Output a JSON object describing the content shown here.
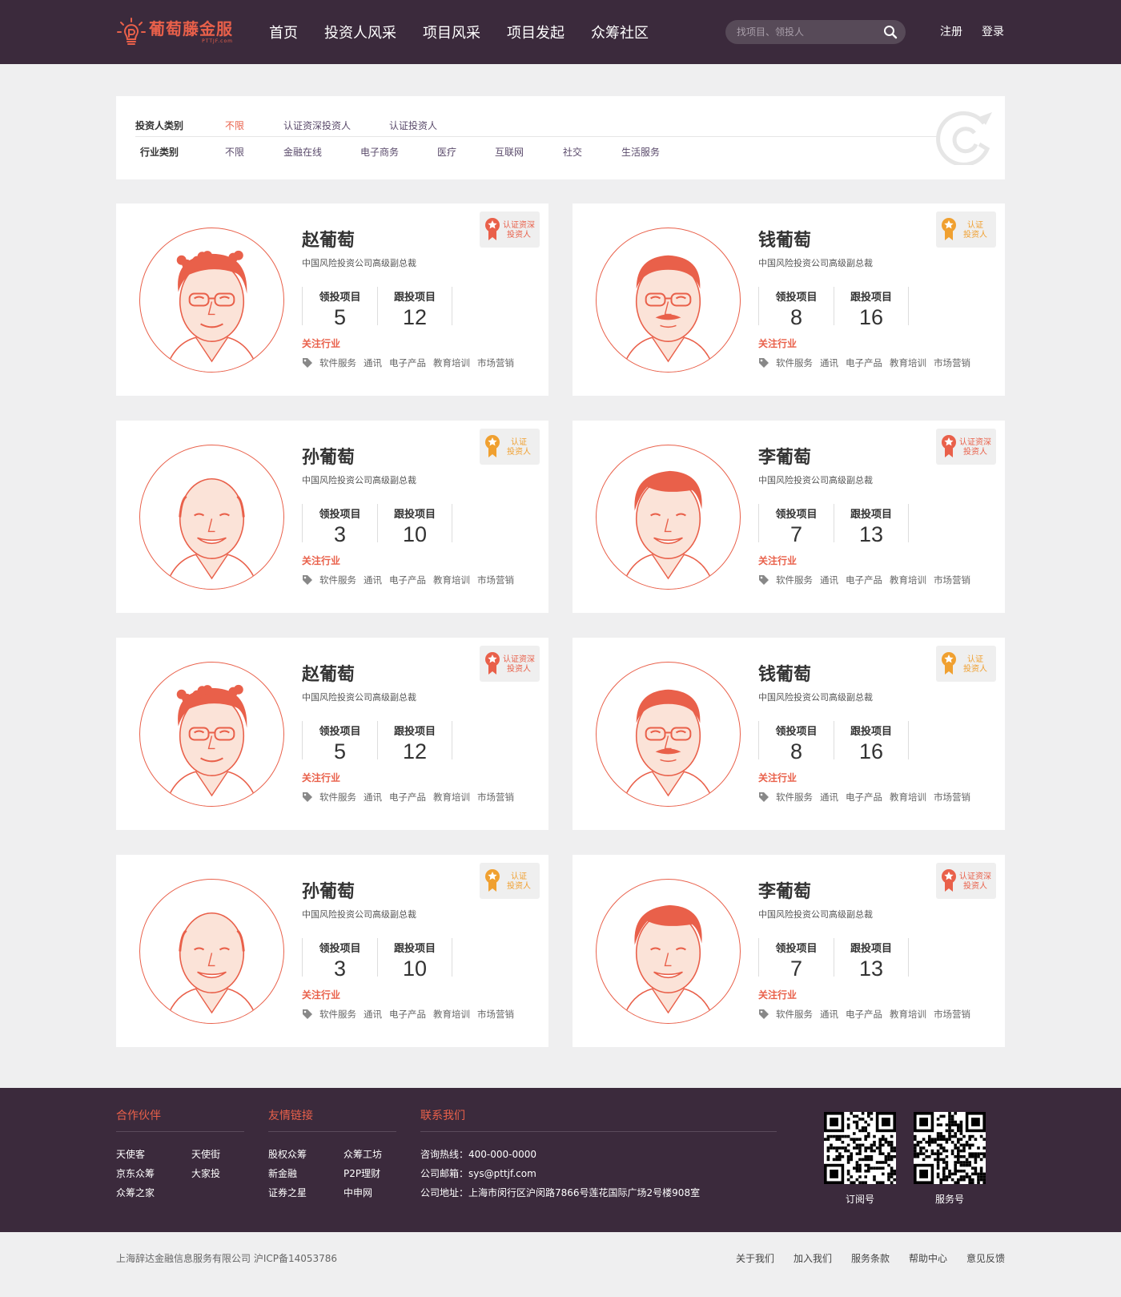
{
  "brand": {
    "name": "葡萄藤金服",
    "domain": "PTTJF.com",
    "accent": "#e9604a",
    "header_bg": "#3b2a3c"
  },
  "nav": [
    "首页",
    "投资人风采",
    "项目风采",
    "项目发起",
    "众筹社区"
  ],
  "search": {
    "placeholder": "找项目、领投人"
  },
  "auth": {
    "register": "注册",
    "login": "登录"
  },
  "filters": {
    "investor_type": {
      "label": "投资人类别",
      "options": [
        "不限",
        "认证资深投资人",
        "认证投资人"
      ],
      "selected": "不限"
    },
    "industry": {
      "label": "行业类别",
      "options": [
        "不限",
        "金融在线",
        "电子商务",
        "医疗",
        "互联网",
        "社交",
        "生活服务"
      ]
    }
  },
  "card_labels": {
    "lead": "领投项目",
    "follow": "跟投项目",
    "industry": "关注行业"
  },
  "badges": {
    "senior": [
      "认证资深",
      "投资人"
    ],
    "normal": [
      "认证",
      "投资人"
    ]
  },
  "investors": [
    {
      "name": "赵葡萄",
      "title": "中国风险投资公司高级副总裁",
      "lead": "5",
      "follow": "12",
      "badge": "senior",
      "face": "curly",
      "tags": [
        "软件服务",
        "通讯",
        "电子产品",
        "教育培训",
        "市场营销"
      ]
    },
    {
      "name": "钱葡萄",
      "title": "中国风险投资公司高级副总裁",
      "lead": "8",
      "follow": "16",
      "badge": "normal",
      "face": "mustache",
      "tags": [
        "软件服务",
        "通讯",
        "电子产品",
        "教育培训",
        "市场营销"
      ]
    },
    {
      "name": "孙葡萄",
      "title": "中国风险投资公司高级副总裁",
      "lead": "3",
      "follow": "10",
      "badge": "normal",
      "face": "bald",
      "tags": [
        "软件服务",
        "通讯",
        "电子产品",
        "教育培训",
        "市场营销"
      ]
    },
    {
      "name": "李葡萄",
      "title": "中国风险投资公司高级副总裁",
      "lead": "7",
      "follow": "13",
      "badge": "senior",
      "face": "parted",
      "tags": [
        "软件服务",
        "通讯",
        "电子产品",
        "教育培训",
        "市场营销"
      ]
    },
    {
      "name": "赵葡萄",
      "title": "中国风险投资公司高级副总裁",
      "lead": "5",
      "follow": "12",
      "badge": "senior",
      "face": "curly",
      "tags": [
        "软件服务",
        "通讯",
        "电子产品",
        "教育培训",
        "市场营销"
      ]
    },
    {
      "name": "钱葡萄",
      "title": "中国风险投资公司高级副总裁",
      "lead": "8",
      "follow": "16",
      "badge": "normal",
      "face": "mustache",
      "tags": [
        "软件服务",
        "通讯",
        "电子产品",
        "教育培训",
        "市场营销"
      ]
    },
    {
      "name": "孙葡萄",
      "title": "中国风险投资公司高级副总裁",
      "lead": "3",
      "follow": "10",
      "badge": "normal",
      "face": "bald",
      "tags": [
        "软件服务",
        "通讯",
        "电子产品",
        "教育培训",
        "市场营销"
      ]
    },
    {
      "name": "李葡萄",
      "title": "中国风险投资公司高级副总裁",
      "lead": "7",
      "follow": "13",
      "badge": "senior",
      "face": "parted",
      "tags": [
        "软件服务",
        "通讯",
        "电子产品",
        "教育培训",
        "市场营销"
      ]
    }
  ],
  "footer": {
    "partners": {
      "title": "合作伙伴",
      "links": [
        "天使客",
        "天使街",
        "京东众筹",
        "大家投",
        "众筹之家"
      ]
    },
    "friends": {
      "title": "友情链接",
      "links": [
        "股权众筹",
        "众筹工坊",
        "新金融",
        "P2P理财",
        "证券之星",
        "中申网"
      ]
    },
    "contact": {
      "title": "联系我们",
      "lines": [
        "咨询热线：400-000-0000",
        "公司邮箱：sys@pttjf.com",
        "公司地址：上海市闵行区沪闵路7866号莲花国际广场2号楼908室"
      ]
    },
    "qr": [
      {
        "label": "订阅号",
        "icon": "qr-code-icon"
      },
      {
        "label": "服务号",
        "icon": "qr-code-icon"
      }
    ]
  },
  "bottom": {
    "copyright": "上海辞达金融信息服务有限公司   沪ICP备14053786",
    "links": [
      "关于我们",
      "加入我们",
      "服务条款",
      "帮助中心",
      "意见反馈"
    ]
  }
}
